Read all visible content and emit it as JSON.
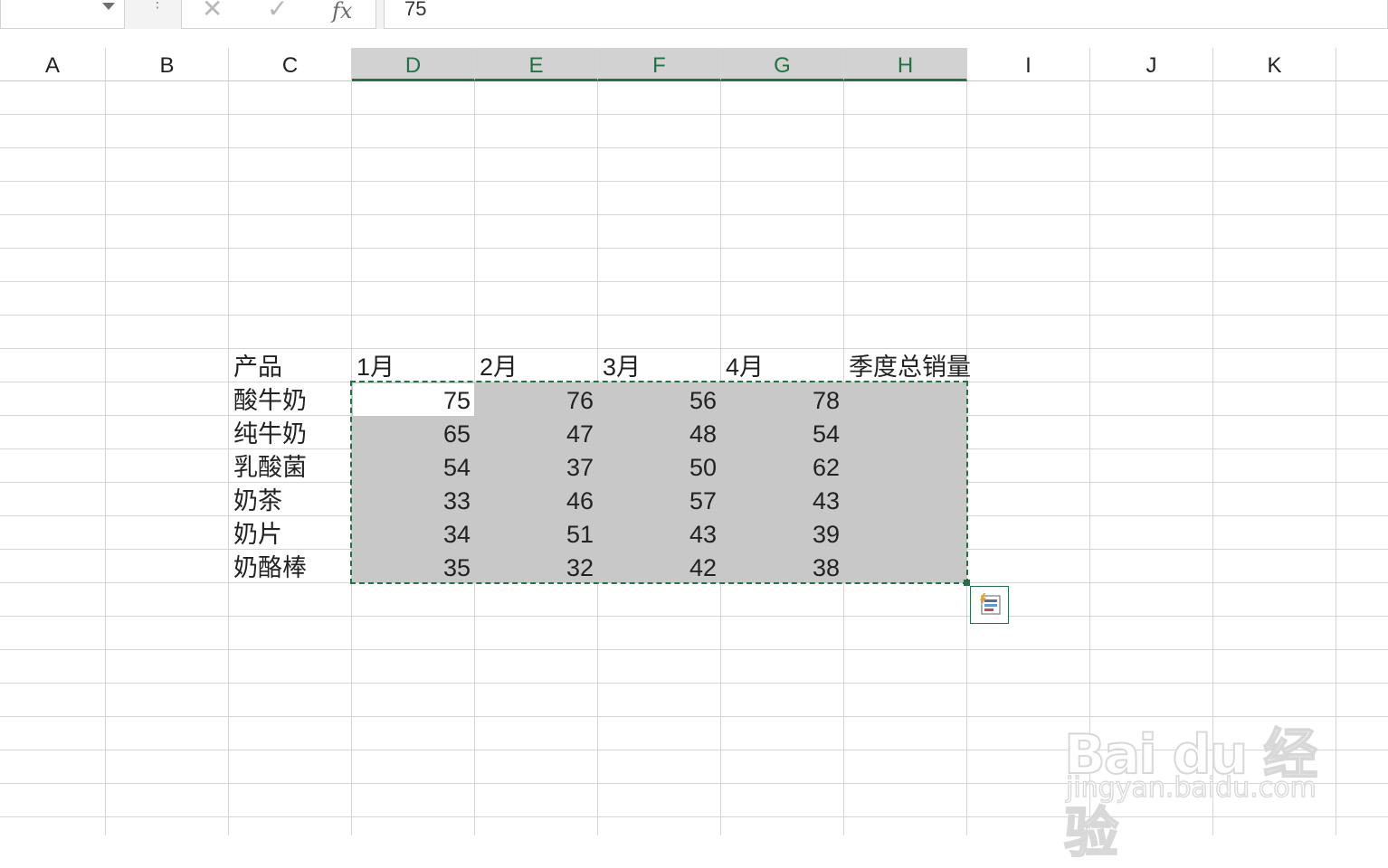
{
  "formula_bar": {
    "formula_value": "75",
    "cancel_glyph": "✕",
    "enter_glyph": "✓",
    "fx_label": "fx",
    "dots_glyph": "⋮"
  },
  "columns": [
    "A",
    "B",
    "C",
    "D",
    "E",
    "F",
    "G",
    "H",
    "I",
    "J",
    "K"
  ],
  "selected_columns": [
    "D",
    "E",
    "F",
    "G",
    "H"
  ],
  "table": {
    "headers": [
      "产品",
      "1月",
      "2月",
      "3月",
      "4月",
      "季度总销量"
    ],
    "rows": [
      {
        "product": "酸牛奶",
        "values": [
          "75",
          "76",
          "56",
          "78"
        ]
      },
      {
        "product": "纯牛奶",
        "values": [
          "65",
          "47",
          "48",
          "54"
        ]
      },
      {
        "product": "乳酸菌",
        "values": [
          "54",
          "37",
          "50",
          "62"
        ]
      },
      {
        "product": "奶茶",
        "values": [
          "33",
          "46",
          "57",
          "43"
        ]
      },
      {
        "product": "奶片",
        "values": [
          "34",
          "51",
          "43",
          "39"
        ]
      },
      {
        "product": "奶酪棒",
        "values": [
          "35",
          "32",
          "42",
          "38"
        ]
      }
    ]
  },
  "watermark": {
    "logo_text": "Bai du 经验",
    "url_text": "jingyan.baidu.com"
  },
  "colors": {
    "accent": "#217346",
    "selection_fill": "#c8c8c8",
    "gridline": "#d6d6d6"
  },
  "icons": {
    "cancel": "close-icon",
    "enter": "check-icon",
    "function": "fx-icon",
    "quick_analysis": "quick-analysis-icon",
    "name_box_dropdown": "chevron-down-icon"
  }
}
